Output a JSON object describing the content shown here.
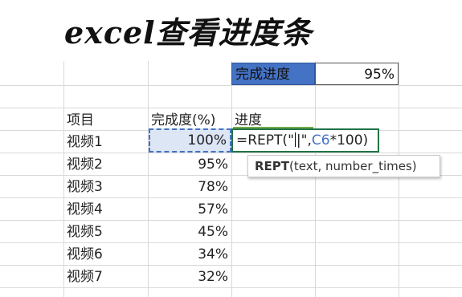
{
  "title": "excel查看进度条",
  "summary": {
    "label": "完成进度",
    "value": "95%"
  },
  "headers": {
    "item": "项目",
    "percent": "完成度(%)",
    "progress": "进度"
  },
  "rows": [
    {
      "name": "视频1",
      "percent": "100%"
    },
    {
      "name": "视频2",
      "percent": "95%"
    },
    {
      "name": "视频3",
      "percent": "78%"
    },
    {
      "name": "视频4",
      "percent": "57%"
    },
    {
      "name": "视频5",
      "percent": "45%"
    },
    {
      "name": "视频6",
      "percent": "34%"
    },
    {
      "name": "视频7",
      "percent": "32%"
    }
  ],
  "formula": {
    "prefix": "=REPT(",
    "quote_open": "\"",
    "bar": "|",
    "quote_close": "\",",
    "ref": "C6",
    "suffix": "*100)"
  },
  "tooltip": {
    "fn": "REPT",
    "args": "(text, number_times)"
  },
  "colors": {
    "summary_fill": "#4472c4",
    "selection": "#4472c4",
    "edit_border": "#217346"
  }
}
